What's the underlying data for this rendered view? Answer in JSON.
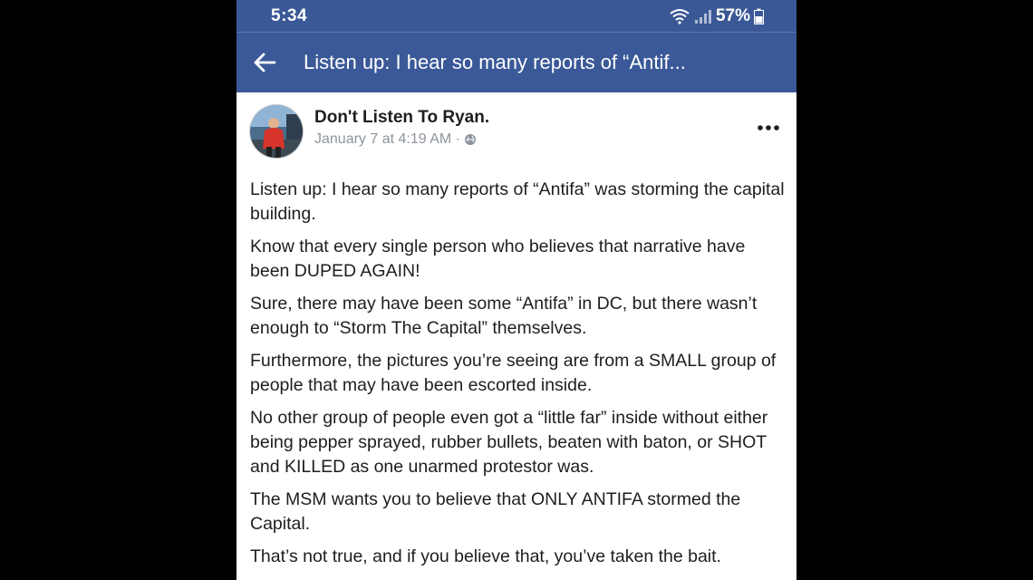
{
  "status_bar": {
    "time": "5:34",
    "battery": "57%"
  },
  "nav": {
    "title": "Listen up: I hear so many reports of “Antif..."
  },
  "post": {
    "author": "Don't Listen To Ryan.",
    "timestamp": "January 7 at 4:19 AM ·",
    "paragraphs": [
      "Listen up: I hear so many reports of “Antifa” was storming the capital building.",
      "Know that every single person who believes that narrative have been DUPED AGAIN!",
      "Sure, there may have been some “Antifa” in DC, but there wasn’t enough to “Storm The Capital” themselves.",
      "Furthermore, the pictures you’re seeing are from a SMALL group of people that may have been escorted inside.",
      "No other group of people even got a “little far” inside without either being pepper sprayed, rubber bullets, beaten with baton, or SHOT and KILLED as one unarmed protestor was.",
      "The MSM wants you to believe that ONLY ANTIFA stormed the Capital.",
      "That’s not true, and if you believe that, you’ve taken the bait."
    ]
  },
  "icons": {
    "back": "arrow-left-icon",
    "more": "ellipsis-icon",
    "privacy": "globe-icon",
    "wifi": "wifi-icon",
    "signal": "signal-icon",
    "battery": "battery-icon"
  },
  "colors": {
    "header_blue": "#3b5998",
    "status_blue": "#3a5896",
    "meta_gray": "#8d949e",
    "text": "#1c1e21"
  }
}
